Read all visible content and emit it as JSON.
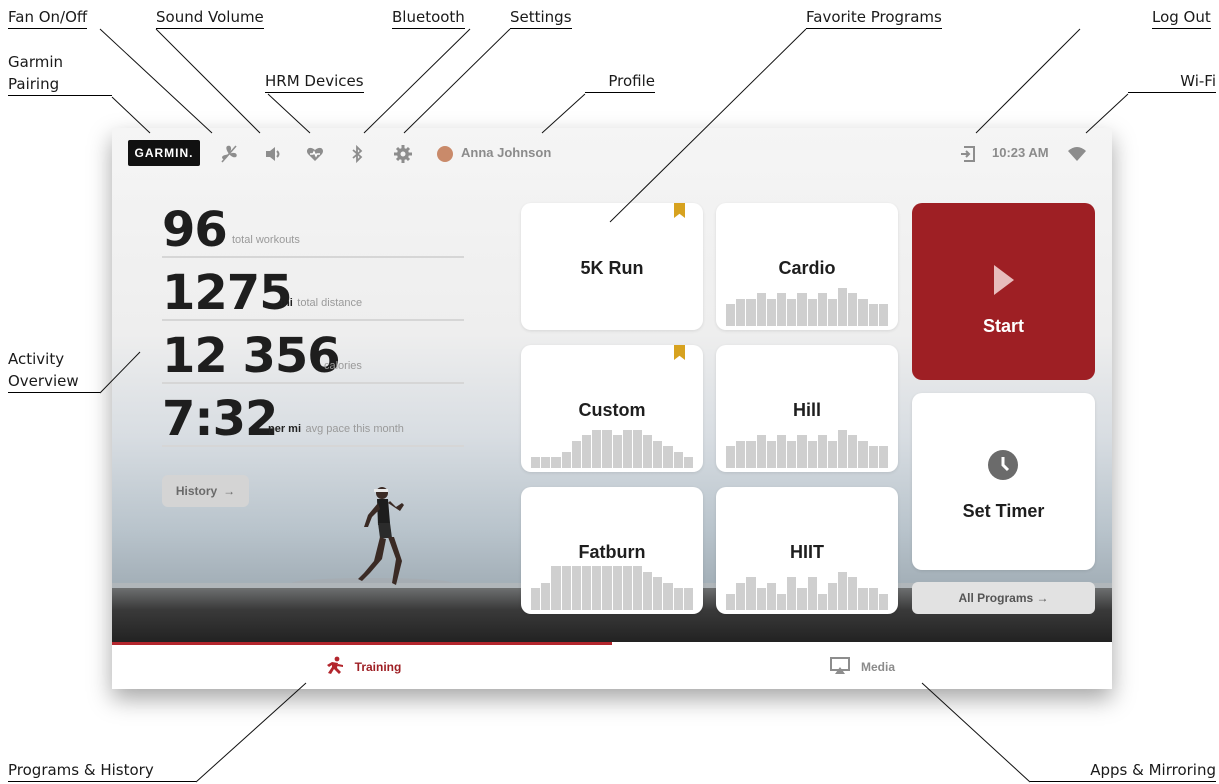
{
  "annotations": {
    "fan": "Fan On/Off",
    "volume": "Sound Volume",
    "bluetooth": "Bluetooth",
    "settings": "Settings",
    "favorites": "Favorite Programs",
    "logout": "Log Out",
    "garmin_line1": "Garmin",
    "garmin_line2": "Pairing",
    "hrm": "HRM Devices",
    "profile": "Profile",
    "wifi": "Wi-Fi",
    "activity_line1": "Activity",
    "activity_line2": "Overview",
    "programs_history": "Programs & History",
    "apps_mirroring": "Apps & Mirroring"
  },
  "topbar": {
    "brand": "GARMIN.",
    "user_name": "Anna Johnson",
    "time": "10:23 AM",
    "icons": [
      "fan-icon",
      "volume-icon",
      "heart-rate-icon",
      "bluetooth-icon",
      "gear-icon",
      "logout-icon",
      "wifi-icon"
    ]
  },
  "stats": [
    {
      "value": "96",
      "unit": "",
      "label": "total workouts"
    },
    {
      "value": "1275",
      "unit": "mi",
      "label": "total distance"
    },
    {
      "value": "12 356",
      "unit": "",
      "label": "calories"
    },
    {
      "value": "7:32",
      "unit": "per mi",
      "label": "avg pace this month"
    }
  ],
  "history_button": "History",
  "programs": [
    {
      "name": "5K Run",
      "favorite": true,
      "profile": []
    },
    {
      "name": "Cardio",
      "favorite": false,
      "profile": [
        4,
        5,
        5,
        6,
        5,
        6,
        5,
        6,
        5,
        6,
        5,
        7,
        6,
        5,
        4,
        4
      ]
    },
    {
      "name": "Custom",
      "favorite": true,
      "profile": [
        2,
        2,
        2,
        3,
        5,
        6,
        7,
        7,
        6,
        7,
        7,
        6,
        5,
        4,
        3,
        2
      ]
    },
    {
      "name": "Hill",
      "favorite": false,
      "profile": [
        4,
        5,
        5,
        6,
        5,
        6,
        5,
        6,
        5,
        6,
        5,
        7,
        6,
        5,
        4,
        4
      ]
    },
    {
      "name": "Fatburn",
      "favorite": false,
      "profile": [
        4,
        5,
        8,
        8,
        8,
        8,
        8,
        8,
        8,
        8,
        8,
        7,
        6,
        5,
        4,
        4
      ]
    },
    {
      "name": "HIIT",
      "favorite": false,
      "profile": [
        3,
        5,
        6,
        4,
        5,
        3,
        6,
        4,
        6,
        3,
        5,
        7,
        6,
        4,
        4,
        3
      ]
    }
  ],
  "start_label": "Start",
  "timer_label": "Set Timer",
  "all_programs": "All Programs",
  "tabs": {
    "training": "Training",
    "media": "Media"
  },
  "colors": {
    "accent": "#9e1f24",
    "bookmark": "#d7a21f"
  }
}
